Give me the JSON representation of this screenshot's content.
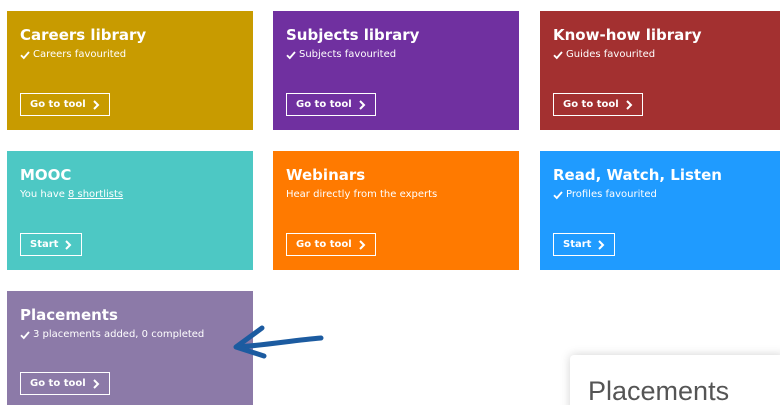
{
  "colors": {
    "careers": "#C89B00",
    "subjects": "#7030A0",
    "knowhow": "#A33030",
    "mooc": "#4DC8C4",
    "webinars": "#FF7A00",
    "read_watch_listen": "#1F9BFF",
    "placements": "#8C7AA8",
    "annotation_arrow": "#1C5BA0"
  },
  "tiles": [
    {
      "title": "Careers library",
      "subtitle": "Careers favourited",
      "button": "Go to tool",
      "icon": "check-icon"
    },
    {
      "title": "Subjects library",
      "subtitle": "Subjects favourited",
      "button": "Go to tool",
      "icon": "check-icon"
    },
    {
      "title": "Know-how library",
      "subtitle": "Guides favourited",
      "button": "Go to tool",
      "icon": "check-icon"
    },
    {
      "title": "MOOC",
      "subtitle_prefix": "You have",
      "subtitle_link": "8 shortlists",
      "button": "Start"
    },
    {
      "title": "Webinars",
      "subtitle": "Hear directly from the experts",
      "button": "Go to tool"
    },
    {
      "title": "Read, Watch, Listen",
      "subtitle": "Profiles favourited",
      "button": "Start",
      "icon": "check-icon"
    },
    {
      "title": "Placements",
      "subtitle": "3 placements added, 0 completed",
      "button": "Go to tool",
      "icon": "check-icon"
    }
  ],
  "popup": {
    "title": "Placements"
  }
}
